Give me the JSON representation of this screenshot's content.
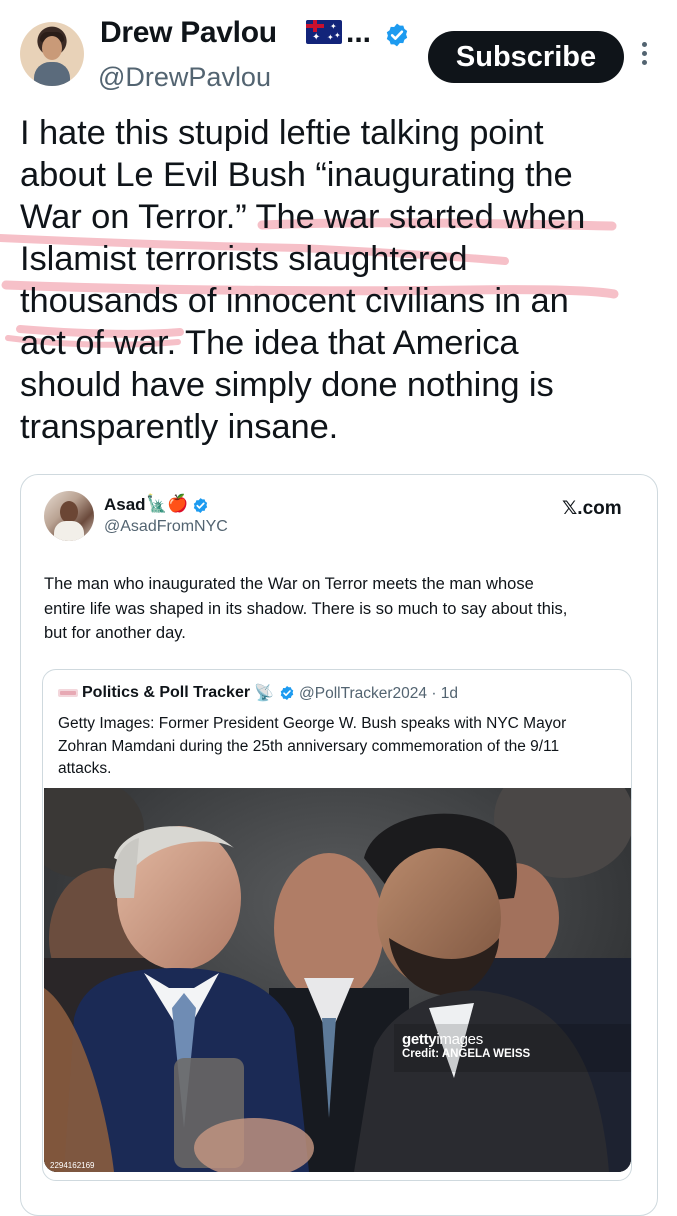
{
  "header": {
    "display_name": "Drew Pavlou",
    "name_ellipsis": "...",
    "flag_icon": "australia-flag-icon",
    "handle": "@DrewPavlou",
    "subscribe_label": "Subscribe",
    "more_icon": "more-vertical-icon"
  },
  "tweet": {
    "lines": [
      "I hate this stupid leftie talking point",
      "about Le Evil Bush “inaugurating the",
      "War on Terror.” The war started when",
      "Islamist terrorists slaughtered",
      "thousands of innocent civilians in an",
      "act of war. The idea that America",
      "should have simply done nothing is",
      "transparently insane."
    ],
    "highlight_color": "#f5b5be"
  },
  "quote": {
    "display_name": "Asad",
    "emoji": [
      "🗽",
      "🍎"
    ],
    "handle": "@AsadFromNYC",
    "source": "𝕏.com",
    "lines": [
      "The man who inaugurated the War on Terror meets the man whose",
      "entire life was shaped in its shadow. There is so much to say about this,",
      "but for another day."
    ],
    "nested": {
      "display_name": "Politics & Poll Tracker",
      "dish_emoji": "📡",
      "handle_time": "@PollTracker2024 · 1d",
      "lines": [
        "Getty Images: Former President George W. Bush speaks with NYC Mayor",
        "Zohran Mamdani during the 25th anniversary commemoration of the 9/11",
        "attacks."
      ],
      "photo": {
        "getty_brand_bold": "getty",
        "getty_brand_light": "images",
        "credit": "Credit: ANGELA WEISS",
        "image_id": "2294162169"
      }
    }
  },
  "colors": {
    "text": "#0f1419",
    "secondary": "#536471",
    "verified_blue": "#1d9bf0",
    "border": "#cfd9de"
  }
}
